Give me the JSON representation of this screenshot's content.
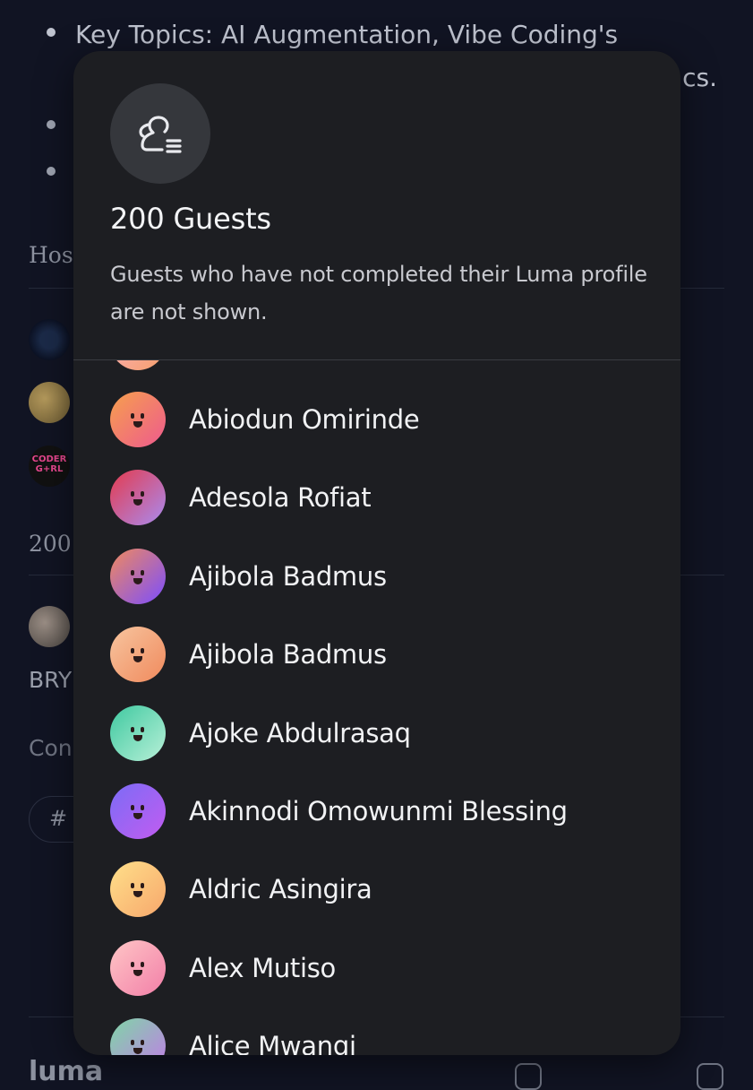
{
  "background_page": {
    "bullet_1": "Key Topics: AI Augmentation,  Vibe Coding's",
    "bullet_1_cont": "cs.",
    "hosts_label": "Host",
    "count_label": "200",
    "name_fragment": "BRY",
    "contact_fragment": "Con",
    "tag_label": "#",
    "footer_logo": "luma",
    "coder_girl_avatar_text": "CODER G+RL"
  },
  "modal": {
    "icon": "guests-list-icon",
    "title": "200 Guests",
    "subtitle": "Guests who have not completed their Luma profile are not shown.",
    "guests": [
      {
        "name": "Abiodun Omirinde",
        "avatar_colors": [
          "#f6a04d",
          "#ee5a8e"
        ]
      },
      {
        "name": "Adesola Rofiat",
        "avatar_colors": [
          "#e43b4e",
          "#a98bf0"
        ]
      },
      {
        "name": "Ajibola Badmus",
        "avatar_colors": [
          "#f08a5d",
          "#7b4dff"
        ]
      },
      {
        "name": "Ajibola Badmus",
        "avatar_colors": [
          "#f7c59f",
          "#f08a5d"
        ]
      },
      {
        "name": "Ajoke Abdulrasaq",
        "avatar_colors": [
          "#3fc9a0",
          "#b8f0d8"
        ]
      },
      {
        "name": "Akinnodi Omowunmi Blessing",
        "avatar_colors": [
          "#7b6cf6",
          "#c25cf0"
        ]
      },
      {
        "name": "Aldric Asingira",
        "avatar_colors": [
          "#ffe08a",
          "#f7a76c"
        ]
      },
      {
        "name": "Alex Mutiso",
        "avatar_colors": [
          "#ffc6c6",
          "#f27fa8"
        ]
      },
      {
        "name": "Alice Mwangi",
        "avatar_colors": [
          "#7fd6a6",
          "#c27be8"
        ]
      }
    ]
  }
}
